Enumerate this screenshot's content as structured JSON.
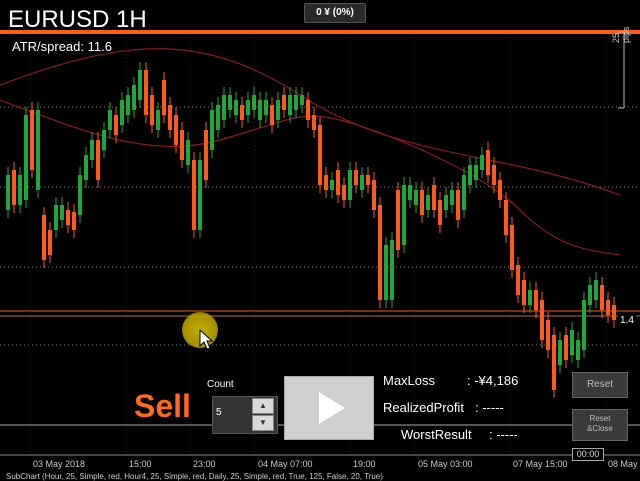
{
  "title": "EURUSD 1H",
  "atr_label": "ATR/spread:",
  "atr_value": "11.6",
  "balance_badge": "0 ¥ (0%)",
  "pips_label": "25 pips",
  "price_label": "1.4",
  "sell_label": "Sell",
  "count": {
    "label": "Count",
    "value": "5",
    "up": "▲",
    "down": "▼"
  },
  "play_icon": "play-icon",
  "stats": {
    "max_loss_label": "MaxLoss",
    "max_loss_value": ": -¥4,186",
    "realized_label": "RealizedProfit",
    "realized_value": ": -----",
    "worst_label": "WorstResult",
    "worst_value": ": -----"
  },
  "buttons": {
    "reset": "Reset",
    "reset_close_1": "Reset",
    "reset_close_2": "&Close"
  },
  "time_axis": [
    "03 May 2018",
    "15:00",
    "23:00",
    "04 May 07:00",
    "19:00",
    "05 May 03:00",
    "07 May 15:00",
    "08 May"
  ],
  "cursor_time": "00:00",
  "status_line": "SubChart (Hour, 25, Simple, red, Hour4, 25, Simple, red, Daily, 25, Simple, red, True, 125, False, 20, True)",
  "colors": {
    "bull": "#1fa83a",
    "bear": "#ff5a1a",
    "accent_line": "#ff5a1a",
    "ma": "#8b1a1a"
  }
}
